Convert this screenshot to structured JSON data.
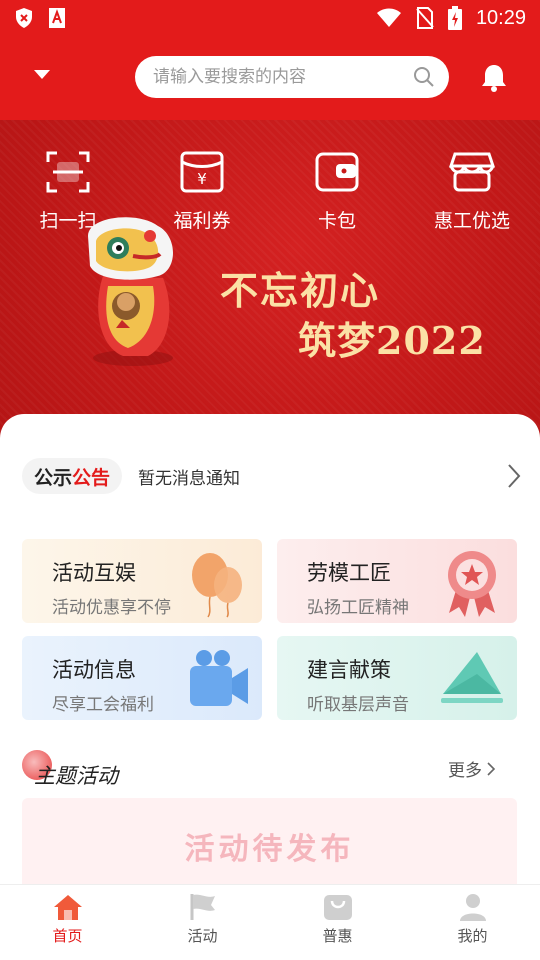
{
  "status": {
    "time": "10:29"
  },
  "search": {
    "placeholder": "请输入要搜索的内容"
  },
  "quick": [
    {
      "label": "扫一扫",
      "icon": "scan-icon"
    },
    {
      "label": "福利券",
      "icon": "coupon-icon"
    },
    {
      "label": "卡包",
      "icon": "wallet-icon"
    },
    {
      "label": "惠工优选",
      "icon": "shop-icon"
    }
  ],
  "banner": {
    "line1": "不忘初心",
    "line2": "筑梦2022"
  },
  "notice": {
    "badge_a": "公示",
    "badge_b": "公告",
    "text": "暂无消息通知"
  },
  "cards": [
    {
      "title": "活动互娱",
      "subtitle": "活动优惠享不停",
      "icon": "balloon-icon",
      "bg": "#fdf3e4"
    },
    {
      "title": "劳模工匠",
      "subtitle": "弘扬工匠精神",
      "icon": "medal-icon",
      "bg": "#fde7e7"
    },
    {
      "title": "活动信息",
      "subtitle": "尽享工会福利",
      "icon": "video-camera-icon",
      "bg": "#e6f0fb"
    },
    {
      "title": "建言献策",
      "subtitle": "听取基层声音",
      "icon": "envelope-icon",
      "bg": "#e3f6f2"
    }
  ],
  "section": {
    "title": "主题活动",
    "more": "更多",
    "pending": "活动待发布"
  },
  "tabs": [
    {
      "label": "首页",
      "icon": "home-icon",
      "active": true
    },
    {
      "label": "活动",
      "icon": "flag-icon",
      "active": false
    },
    {
      "label": "普惠",
      "icon": "shopping-bag-icon",
      "active": false
    },
    {
      "label": "我的",
      "icon": "user-icon",
      "active": false
    }
  ],
  "colors": {
    "brand": "#e31b1b",
    "slogan": "#fbe1a6"
  }
}
